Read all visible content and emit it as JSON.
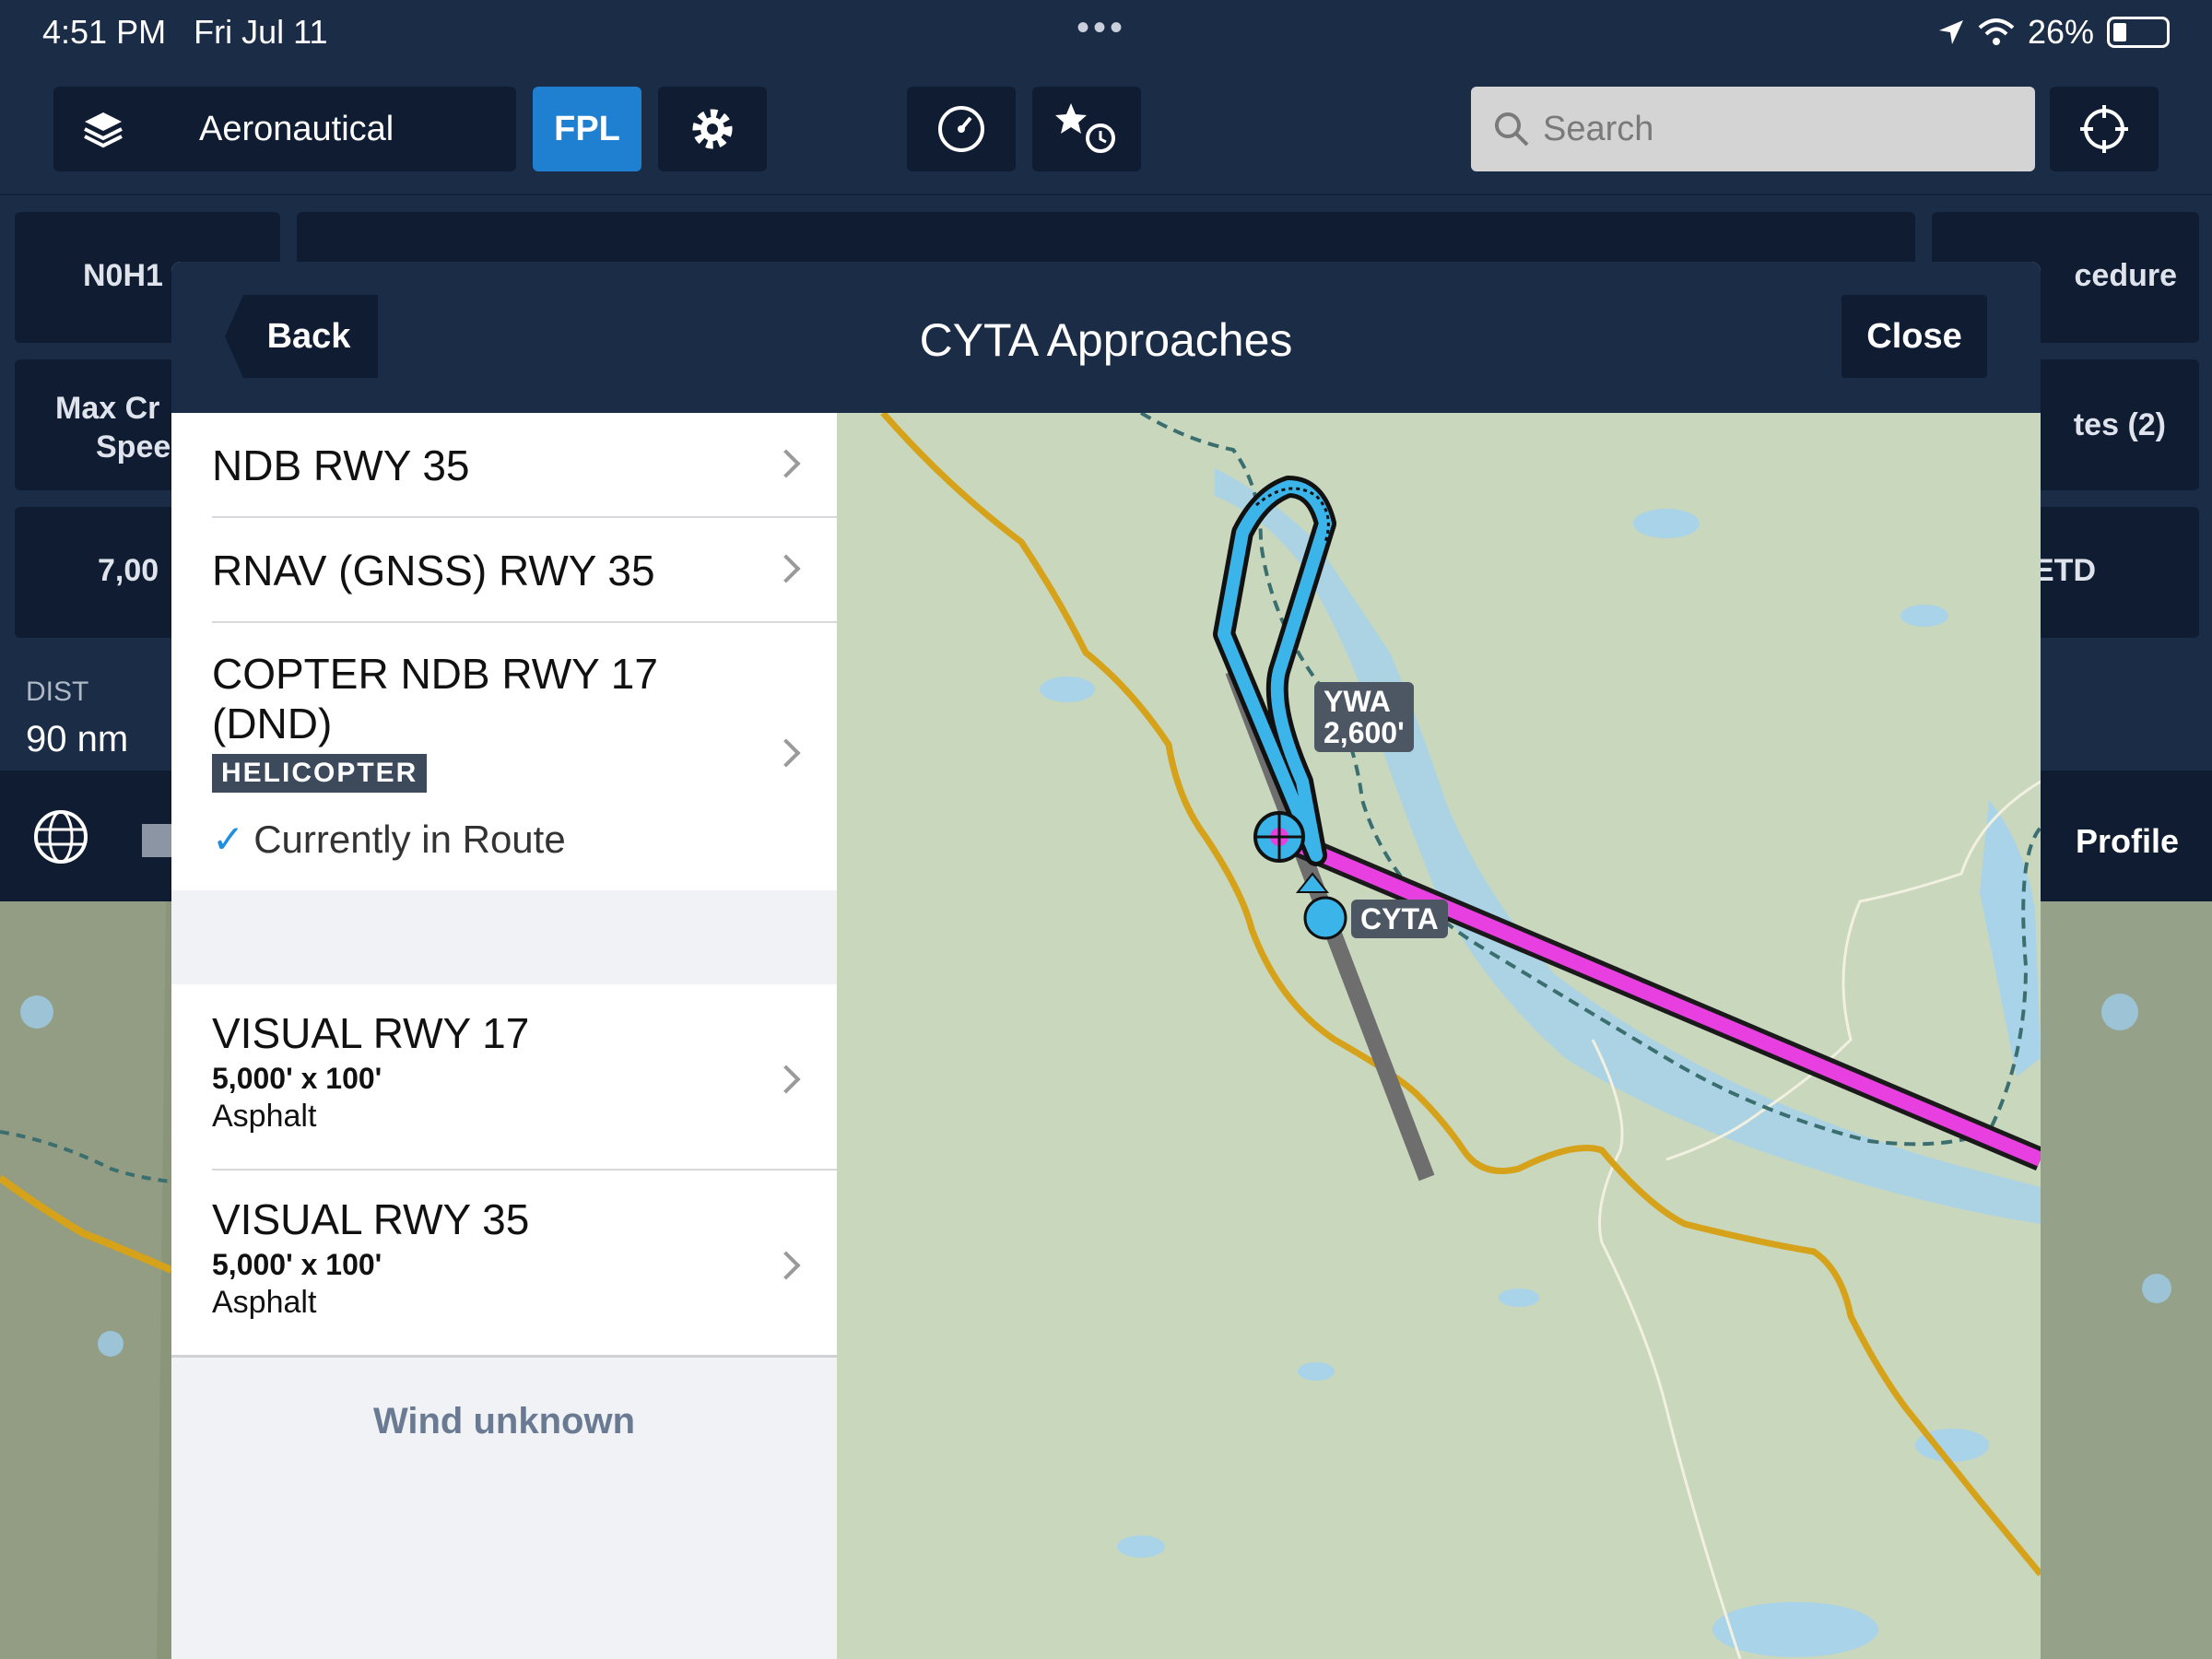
{
  "status_bar": {
    "time": "4:51 PM",
    "date": "Fri Jul 11",
    "battery": "26%"
  },
  "toolbar": {
    "layers_label": "Aeronautical",
    "fpl_label": "FPL",
    "search_placeholder": "Search"
  },
  "background_panel": {
    "aircraft": "N0H1",
    "max_cruise_line1": "Max Cr",
    "max_cruise_line2": "Spee",
    "altitude": "7,00",
    "procedure": "cedure",
    "routes": "tes (2)",
    "etd": "ETD",
    "dist_label": "DIST",
    "dist_value": "90 nm",
    "profile": "Profile"
  },
  "modal": {
    "title": "CYTA Approaches",
    "back_label": "Back",
    "close_label": "Close",
    "approaches": [
      {
        "name": "NDB RWY 35"
      },
      {
        "name": "RNAV (GNSS) RWY 35"
      },
      {
        "name_line1": "COPTER NDB RWY 17",
        "name_line2": "(DND)",
        "badge": "HELICOPTER",
        "status": "Currently in Route"
      }
    ],
    "runways": [
      {
        "name": "VISUAL RWY 17",
        "size": "5,000' x 100'",
        "surface": "Asphalt"
      },
      {
        "name": "VISUAL RWY 35",
        "size": "5,000' x 100'",
        "surface": "Asphalt"
      }
    ],
    "wind": "Wind unknown",
    "map_labels": {
      "fix": "YWA",
      "fix_alt": "2,600'",
      "airport": "CYTA"
    }
  },
  "colors": {
    "accent": "#1f7fd0",
    "route": "#e840e0",
    "approach": "#3bb4ea",
    "boundary": "#d6a21a"
  }
}
